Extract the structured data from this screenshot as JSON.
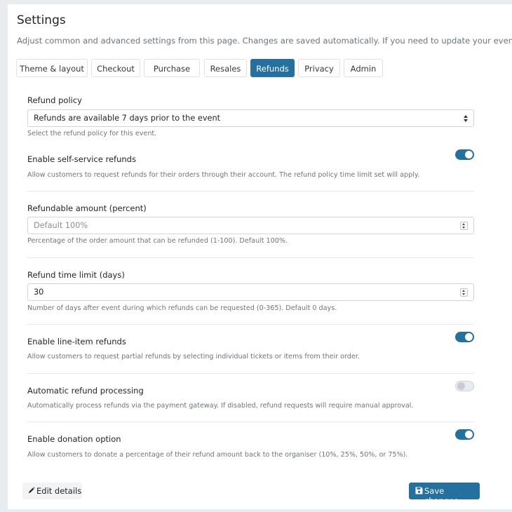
{
  "header": {
    "title": "Settings",
    "subtitle": "Adjust common and advanced settings from this page. Changes are saved automatically. If you need to update your event's content, use th"
  },
  "tabs": [
    {
      "label": "Theme & layout",
      "active": false
    },
    {
      "label": "Checkout",
      "active": false
    },
    {
      "label": "Purchase",
      "active": false
    },
    {
      "label": "Resales",
      "active": false
    },
    {
      "label": "Refunds",
      "active": true
    },
    {
      "label": "Privacy",
      "active": false
    },
    {
      "label": "Admin",
      "active": false
    }
  ],
  "refund_policy": {
    "label": "Refund policy",
    "selected": "Refunds are available 7 days prior to the event",
    "help": "Select the refund policy for this event."
  },
  "self_service": {
    "label": "Enable self-service refunds",
    "enabled": true,
    "help": "Allow customers to request refunds for their orders through their account. The refund policy time limit set will apply."
  },
  "refundable_amount": {
    "label": "Refundable amount (percent)",
    "value": "",
    "placeholder": "Default 100%",
    "help": "Percentage of the order amount that can be refunded (1-100). Default 100%."
  },
  "time_limit": {
    "label": "Refund time limit (days)",
    "value": "30",
    "help": "Number of days after event during which refunds can be requested (0-365). Default 0 days."
  },
  "line_item": {
    "label": "Enable line-item refunds",
    "enabled": true,
    "help": "Allow customers to request partial refunds by selecting individual tickets or items from their order."
  },
  "auto_processing": {
    "label": "Automatic refund processing",
    "enabled": false,
    "help": "Automatically process refunds via the payment gateway. If disabled, refund requests will require manual approval."
  },
  "donation": {
    "label": "Enable donation option",
    "enabled": true,
    "help": "Allow customers to donate a percentage of their refund amount back to the organiser (10%, 25%, 50%, or 75%)."
  },
  "footer": {
    "edit_label": "Edit details",
    "save_label": "Save changes",
    "edit_icon": "pencil-icon",
    "save_icon": "floppy-disk-icon"
  },
  "colors": {
    "accent": "#24709f",
    "page_bg": "#e9ecef",
    "muted_text": "#6c757d"
  }
}
